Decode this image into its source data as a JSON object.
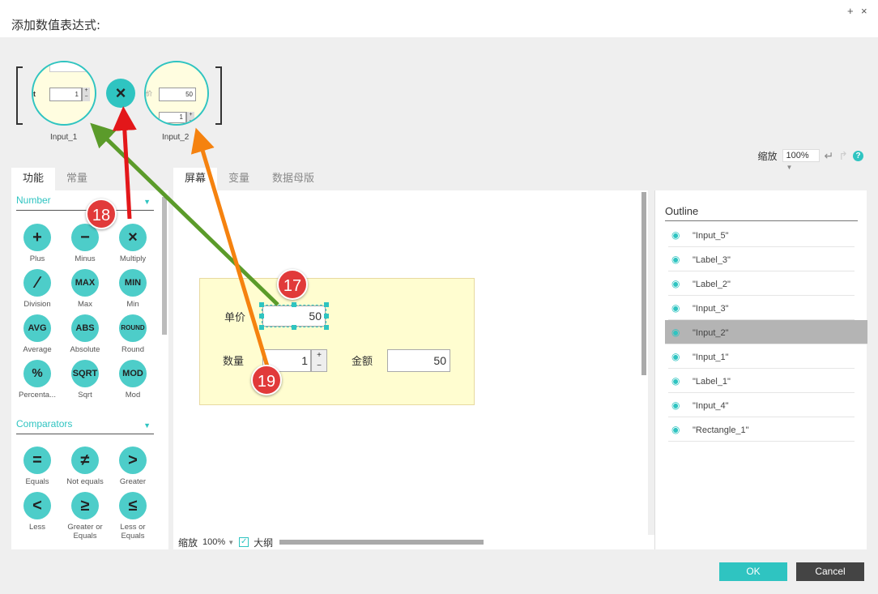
{
  "window": {
    "title": "添加数值表达式:",
    "buttons": [
      "+",
      "×"
    ]
  },
  "expression": {
    "left_operand": {
      "label": "Input_1",
      "value": "1",
      "side_glyph": "t"
    },
    "operator": "×",
    "right_operand": {
      "label": "Input_2",
      "value": "50",
      "stepper_value": "1",
      "side_glyph": "价"
    }
  },
  "zoom_toolbar": {
    "label": "缩放",
    "value": "100%",
    "help": "?"
  },
  "left_tabs": [
    "功能",
    "常量"
  ],
  "sections": {
    "number": {
      "title": "Number",
      "functions": [
        {
          "symbol": "+",
          "label": "Plus"
        },
        {
          "symbol": "−",
          "label": "Minus"
        },
        {
          "symbol": "×",
          "label": "Multiply"
        },
        {
          "symbol": "∕",
          "label": "Division"
        },
        {
          "symbol": "MAX",
          "label": "Max"
        },
        {
          "symbol": "MIN",
          "label": "Min"
        },
        {
          "symbol": "AVG",
          "label": "Average"
        },
        {
          "symbol": "ABS",
          "label": "Absolute"
        },
        {
          "symbol": "ROUND",
          "label": "Round"
        },
        {
          "symbol": "%",
          "label": "Percenta..."
        },
        {
          "symbol": "SQRT",
          "label": "Sqrt"
        },
        {
          "symbol": "MOD",
          "label": "Mod"
        }
      ]
    },
    "comparators": {
      "title": "Comparators",
      "functions": [
        {
          "symbol": "=",
          "label": "Equals"
        },
        {
          "symbol": "≠",
          "label": "Not equals"
        },
        {
          "symbol": ">",
          "label": "Greater"
        },
        {
          "symbol": "<",
          "label": "Less"
        },
        {
          "symbol": "≥",
          "label": "Greater or Equals"
        },
        {
          "symbol": "≤",
          "label": "Less or Equals"
        }
      ]
    }
  },
  "center_tabs": [
    "屏幕",
    "变量",
    "数据母版"
  ],
  "form": {
    "price_label": "单价",
    "price_value": "50",
    "qty_label": "数量",
    "qty_value": "1",
    "amount_label": "金额",
    "amount_value": "50",
    "stepper_plus": "+",
    "stepper_minus": "−"
  },
  "bottom_bar": {
    "zoom_label": "缩放",
    "zoom_value": "100%",
    "outline_label": "大纲",
    "check": "✓"
  },
  "outline": {
    "title": "Outline",
    "items": [
      "\"Input_5\"",
      "\"Label_3\"",
      "\"Label_2\"",
      "\"Input_3\"",
      "\"Input_2\"",
      "\"Input_1\"",
      "\"Label_1\"",
      "\"Input_4\"",
      "\"Rectangle_1\""
    ],
    "selected_index": 4
  },
  "buttons": {
    "ok": "OK",
    "cancel": "Cancel"
  },
  "annotations": {
    "badge_17": "17",
    "badge_18": "18",
    "badge_19": "19",
    "colors": {
      "red": "#e3171a",
      "green": "#5b9b2a",
      "orange": "#f5820f",
      "badge": "#e13a3a"
    }
  },
  "colors": {
    "accent": "#2fc4c1",
    "ok_button": "#2fc4c1",
    "cancel_button": "#444444",
    "selection": "#b4b4b4"
  }
}
